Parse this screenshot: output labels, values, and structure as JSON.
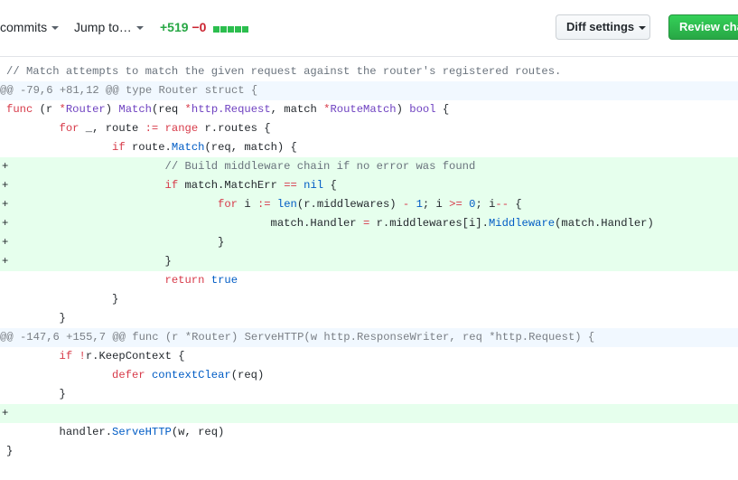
{
  "toolbar": {
    "commits_label": "commits",
    "jump_label": "Jump to…",
    "additions": "+519",
    "deletions": "−0",
    "diff_settings_label": "Diff settings",
    "review_label": "Review changes"
  },
  "diff": {
    "lines": [
      {
        "type": "context",
        "marker": "",
        "tokens": [
          {
            "t": "cm",
            "v": "// Match attempts to match the given request against the router's registered routes."
          }
        ]
      },
      {
        "type": "hunk",
        "marker": "",
        "tokens": [
          {
            "t": "",
            "v": "@@ -79,6 +81,12 @@ type Router struct {"
          }
        ]
      },
      {
        "type": "context",
        "marker": "",
        "tokens": [
          {
            "t": "kw",
            "v": "func"
          },
          {
            "t": "t",
            "v": " (r "
          },
          {
            "t": "kw",
            "v": "*"
          },
          {
            "t": "fn",
            "v": "Router"
          },
          {
            "t": "t",
            "v": ") "
          },
          {
            "t": "fn",
            "v": "Match"
          },
          {
            "t": "t",
            "v": "(req "
          },
          {
            "t": "kw",
            "v": "*"
          },
          {
            "t": "fn",
            "v": "http.Request"
          },
          {
            "t": "t",
            "v": ", match "
          },
          {
            "t": "kw",
            "v": "*"
          },
          {
            "t": "fn",
            "v": "RouteMatch"
          },
          {
            "t": "t",
            "v": ") "
          },
          {
            "t": "fn",
            "v": "bool"
          },
          {
            "t": "t",
            "v": " {"
          }
        ]
      },
      {
        "type": "context",
        "marker": "",
        "tokens": [
          {
            "t": "t",
            "v": "        "
          },
          {
            "t": "kw",
            "v": "for"
          },
          {
            "t": "t",
            "v": " _, route "
          },
          {
            "t": "kw",
            "v": ":="
          },
          {
            "t": "t",
            "v": " "
          },
          {
            "t": "kw",
            "v": "range"
          },
          {
            "t": "t",
            "v": " r.routes {"
          }
        ]
      },
      {
        "type": "context",
        "marker": "",
        "tokens": [
          {
            "t": "t",
            "v": "                "
          },
          {
            "t": "kw",
            "v": "if"
          },
          {
            "t": "t",
            "v": " route."
          },
          {
            "t": "bi",
            "v": "Match"
          },
          {
            "t": "t",
            "v": "(req, match) {"
          }
        ]
      },
      {
        "type": "added",
        "marker": "+",
        "tokens": [
          {
            "t": "t",
            "v": "                        "
          },
          {
            "t": "cm",
            "v": "// Build middleware chain if no error was found"
          }
        ]
      },
      {
        "type": "added",
        "marker": "+",
        "tokens": [
          {
            "t": "t",
            "v": "                        "
          },
          {
            "t": "kw",
            "v": "if"
          },
          {
            "t": "t",
            "v": " match.MatchErr "
          },
          {
            "t": "kw",
            "v": "=="
          },
          {
            "t": "t",
            "v": " "
          },
          {
            "t": "bi",
            "v": "nil"
          },
          {
            "t": "t",
            "v": " {"
          }
        ]
      },
      {
        "type": "added",
        "marker": "+",
        "tokens": [
          {
            "t": "t",
            "v": "                                "
          },
          {
            "t": "kw",
            "v": "for"
          },
          {
            "t": "t",
            "v": " i "
          },
          {
            "t": "kw",
            "v": ":="
          },
          {
            "t": "t",
            "v": " "
          },
          {
            "t": "bi",
            "v": "len"
          },
          {
            "t": "t",
            "v": "(r.middlewares) "
          },
          {
            "t": "kw",
            "v": "-"
          },
          {
            "t": "t",
            "v": " "
          },
          {
            "t": "bi",
            "v": "1"
          },
          {
            "t": "t",
            "v": "; i "
          },
          {
            "t": "kw",
            "v": ">="
          },
          {
            "t": "t",
            "v": " "
          },
          {
            "t": "bi",
            "v": "0"
          },
          {
            "t": "t",
            "v": "; i"
          },
          {
            "t": "kw",
            "v": "--"
          },
          {
            "t": "t",
            "v": " {"
          }
        ]
      },
      {
        "type": "added",
        "marker": "+",
        "tokens": [
          {
            "t": "t",
            "v": "                                        match.Handler "
          },
          {
            "t": "kw",
            "v": "="
          },
          {
            "t": "t",
            "v": " r.middlewares[i]."
          },
          {
            "t": "bi",
            "v": "Middleware"
          },
          {
            "t": "t",
            "v": "(match.Handler)"
          }
        ]
      },
      {
        "type": "added",
        "marker": "+",
        "tokens": [
          {
            "t": "t",
            "v": "                                }"
          }
        ]
      },
      {
        "type": "added",
        "marker": "+",
        "tokens": [
          {
            "t": "t",
            "v": "                        }"
          }
        ]
      },
      {
        "type": "context",
        "marker": "",
        "tokens": [
          {
            "t": "t",
            "v": "                        "
          },
          {
            "t": "kw",
            "v": "return"
          },
          {
            "t": "t",
            "v": " "
          },
          {
            "t": "bi",
            "v": "true"
          }
        ]
      },
      {
        "type": "context",
        "marker": "",
        "tokens": [
          {
            "t": "t",
            "v": "                }"
          }
        ]
      },
      {
        "type": "context",
        "marker": "",
        "tokens": [
          {
            "t": "t",
            "v": "        }"
          }
        ]
      },
      {
        "type": "hunk",
        "marker": "",
        "tokens": [
          {
            "t": "",
            "v": "@@ -147,6 +155,7 @@ func (r *Router) ServeHTTP(w http.ResponseWriter, req *http.Request) {"
          }
        ]
      },
      {
        "type": "context",
        "marker": "",
        "tokens": [
          {
            "t": "t",
            "v": "        "
          },
          {
            "t": "kw",
            "v": "if"
          },
          {
            "t": "t",
            "v": " "
          },
          {
            "t": "kw",
            "v": "!"
          },
          {
            "t": "t",
            "v": "r.KeepContext {"
          }
        ]
      },
      {
        "type": "context",
        "marker": "",
        "tokens": [
          {
            "t": "t",
            "v": "                "
          },
          {
            "t": "kw",
            "v": "defer"
          },
          {
            "t": "t",
            "v": " "
          },
          {
            "t": "bi",
            "v": "contextClear"
          },
          {
            "t": "t",
            "v": "(req)"
          }
        ]
      },
      {
        "type": "context",
        "marker": "",
        "tokens": [
          {
            "t": "t",
            "v": "        }"
          }
        ]
      },
      {
        "type": "added",
        "marker": "+",
        "tokens": [
          {
            "t": "t",
            "v": ""
          }
        ]
      },
      {
        "type": "context",
        "marker": "",
        "tokens": [
          {
            "t": "t",
            "v": "        handler."
          },
          {
            "t": "bi",
            "v": "ServeHTTP"
          },
          {
            "t": "t",
            "v": "(w, req)"
          }
        ]
      },
      {
        "type": "context",
        "marker": "",
        "tokens": [
          {
            "t": "t",
            "v": "}"
          }
        ]
      }
    ]
  }
}
